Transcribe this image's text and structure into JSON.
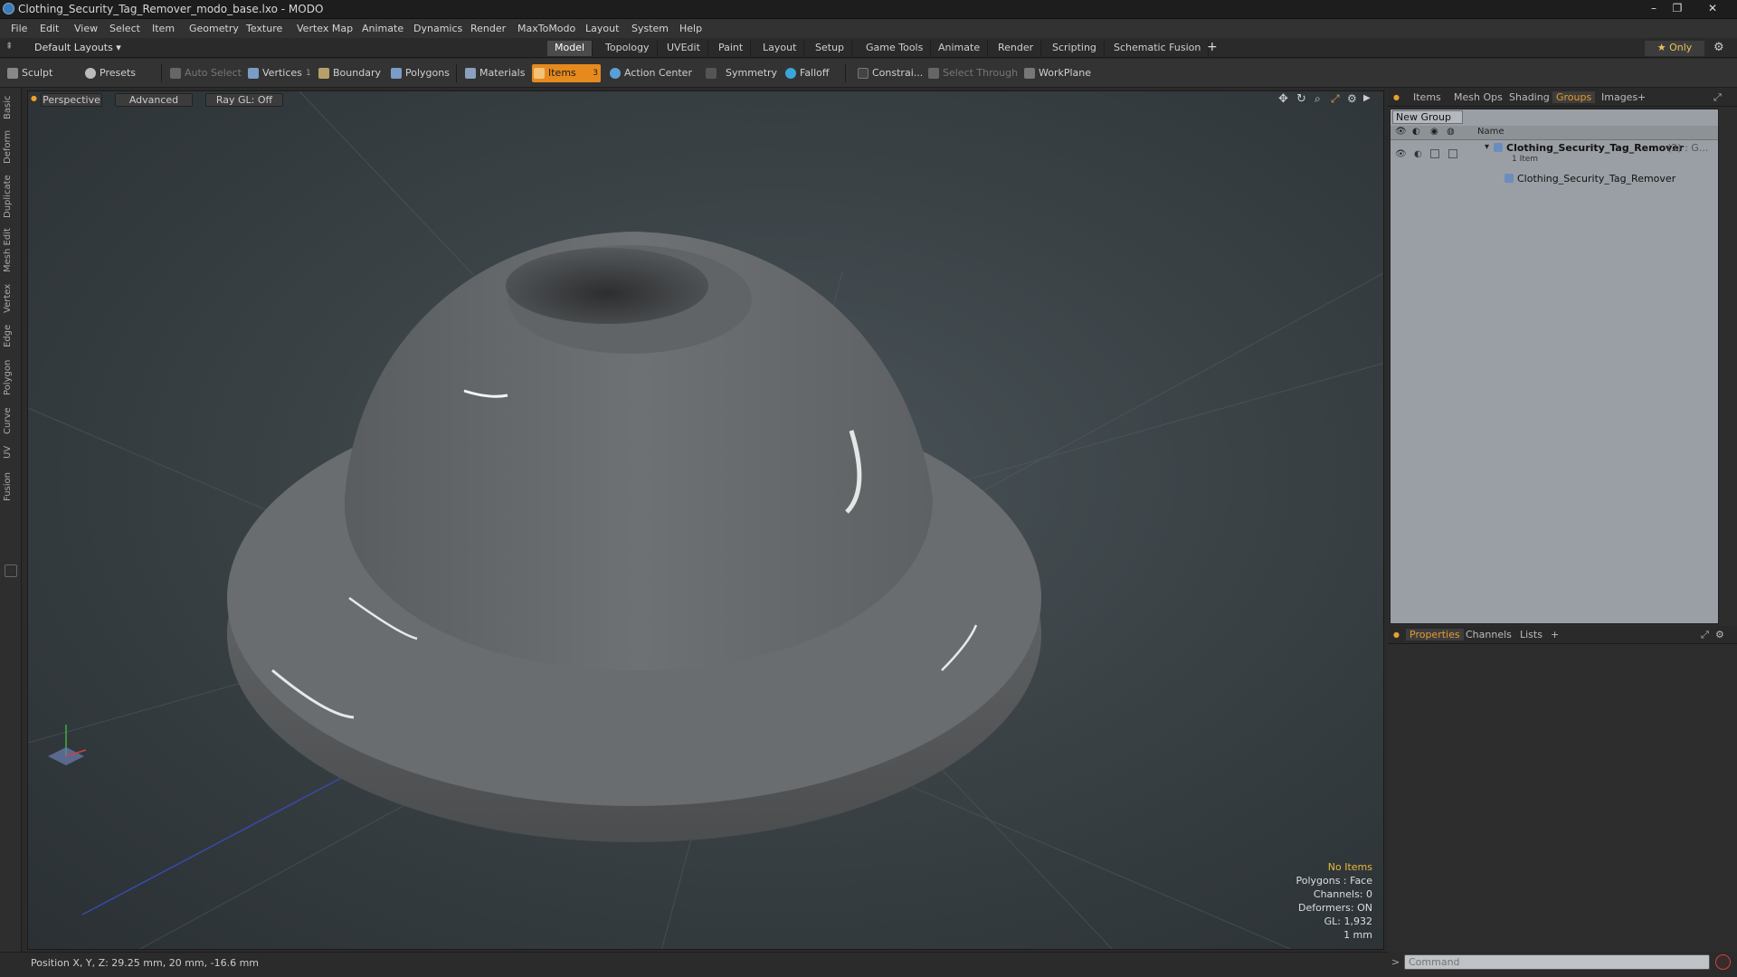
{
  "window": {
    "title": "Clothing_Security_Tag_Remover_modo_base.lxo - MODO",
    "minimize": "–",
    "maximize": "❐",
    "close": "✕"
  },
  "menu": [
    "File",
    "Edit",
    "View",
    "Select",
    "Item",
    "Geometry",
    "Texture",
    "Vertex Map",
    "Animate",
    "Dynamics",
    "Render",
    "MaxToModo",
    "Layout",
    "System",
    "Help"
  ],
  "layout_bar": {
    "layouts_label": "Default Layouts ▾",
    "tabs": [
      "Model",
      "Topology",
      "UVEdit",
      "Paint",
      "Layout",
      "Setup",
      "Game Tools",
      "Animate",
      "Render",
      "Scripting",
      "Schematic Fusion"
    ],
    "active_tab": "Model",
    "add": "+",
    "only_label": "★  Only"
  },
  "toolbar": {
    "sculpt": "Sculpt",
    "presets": "Presets",
    "auto_select": "Auto Select",
    "vertices": "Vertices",
    "vertices_count": "1",
    "boundary": "Boundary",
    "polygons": "Polygons",
    "materials": "Materials",
    "items": "Items",
    "items_count": "3",
    "action_center": "Action Center",
    "symmetry": "Symmetry",
    "falloff": "Falloff",
    "constraints": "Constrai...",
    "select_through": "Select Through",
    "workplane": "WorkPlane"
  },
  "left_tabs": [
    "Basic",
    "Deform",
    "Duplicate",
    "Mesh Edit",
    "Vertex",
    "Edge",
    "Polygon",
    "Curve",
    "UV",
    "Fusion"
  ],
  "viewport": {
    "view": "Perspective",
    "shading": "Advanced",
    "raygl": "Ray GL: Off",
    "info": {
      "selection": "No Items",
      "polygons": "Polygons : Face",
      "channels": "Channels: 0",
      "deformers": "Deformers: ON",
      "gl": "GL: 1,932",
      "scale": "1 mm"
    }
  },
  "status": {
    "position": "Position X, Y, Z:  29.25 mm, 20 mm, -16.6 mm"
  },
  "right_panel": {
    "tabs": [
      "Items",
      "Mesh Ops",
      "Shading",
      "Groups",
      "Images"
    ],
    "active_tab": "Groups",
    "add": "+",
    "new_group": "New Group",
    "column_name": "Name",
    "group_name": "Clothing_Security_Tag_Remover",
    "group_suffix": "(2) : G...",
    "group_count": "1 Item",
    "child_name": "Clothing_Security_Tag_Remover",
    "bottom_tabs": [
      "Properties",
      "Channels",
      "Lists"
    ],
    "bottom_active": "Properties",
    "command_placeholder": "Command"
  },
  "colors": {
    "accent": "#e68a1e",
    "info_highlight": "#e8b83c"
  }
}
